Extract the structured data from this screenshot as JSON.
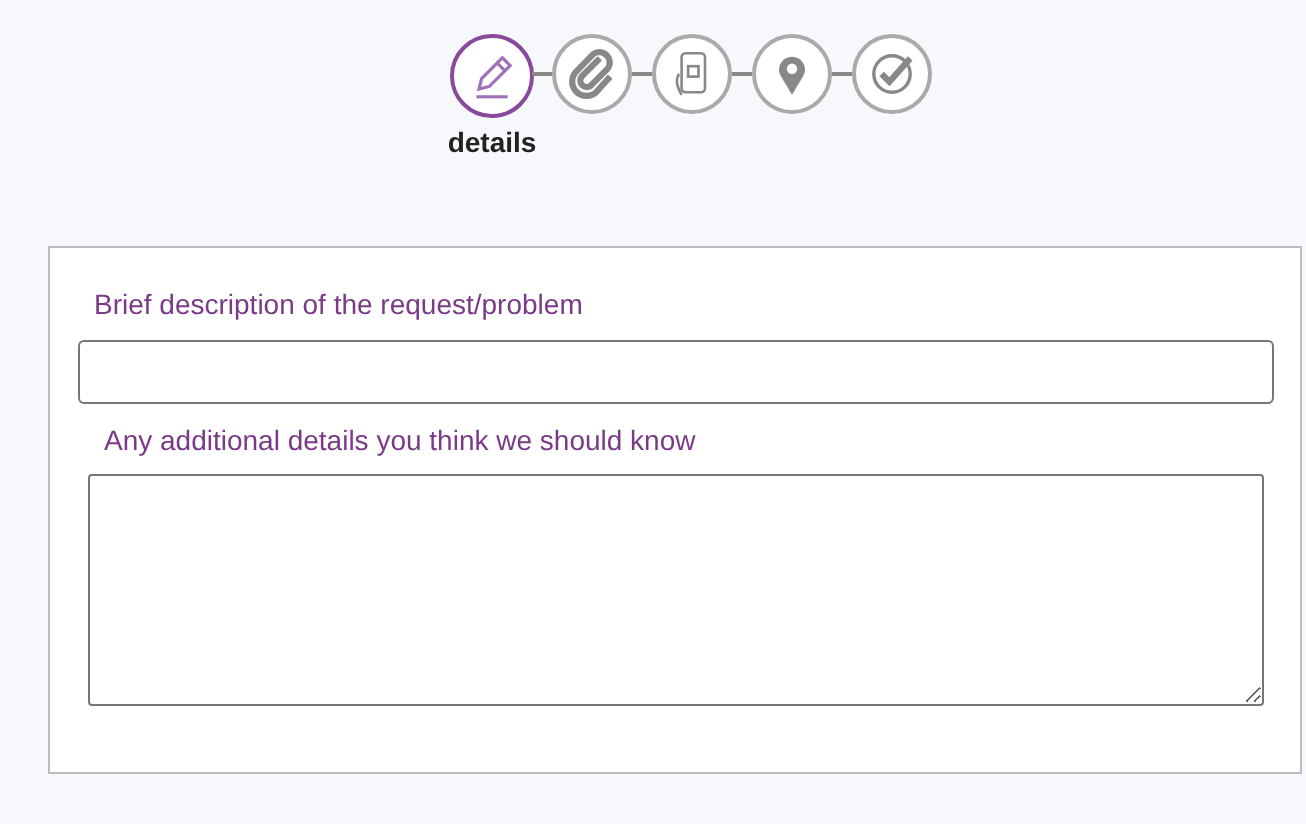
{
  "steps": [
    {
      "kind": "pencil",
      "selected": true,
      "label": "details"
    },
    {
      "kind": "paperclip",
      "selected": false
    },
    {
      "kind": "phone",
      "selected": false
    },
    {
      "kind": "pin",
      "selected": false
    },
    {
      "kind": "check",
      "selected": false
    }
  ],
  "form": {
    "fields": [
      {
        "kind": "input",
        "label": "Brief description of the request/problem"
      },
      {
        "kind": "textarea",
        "label": "Any additional details you think we should know"
      }
    ]
  }
}
